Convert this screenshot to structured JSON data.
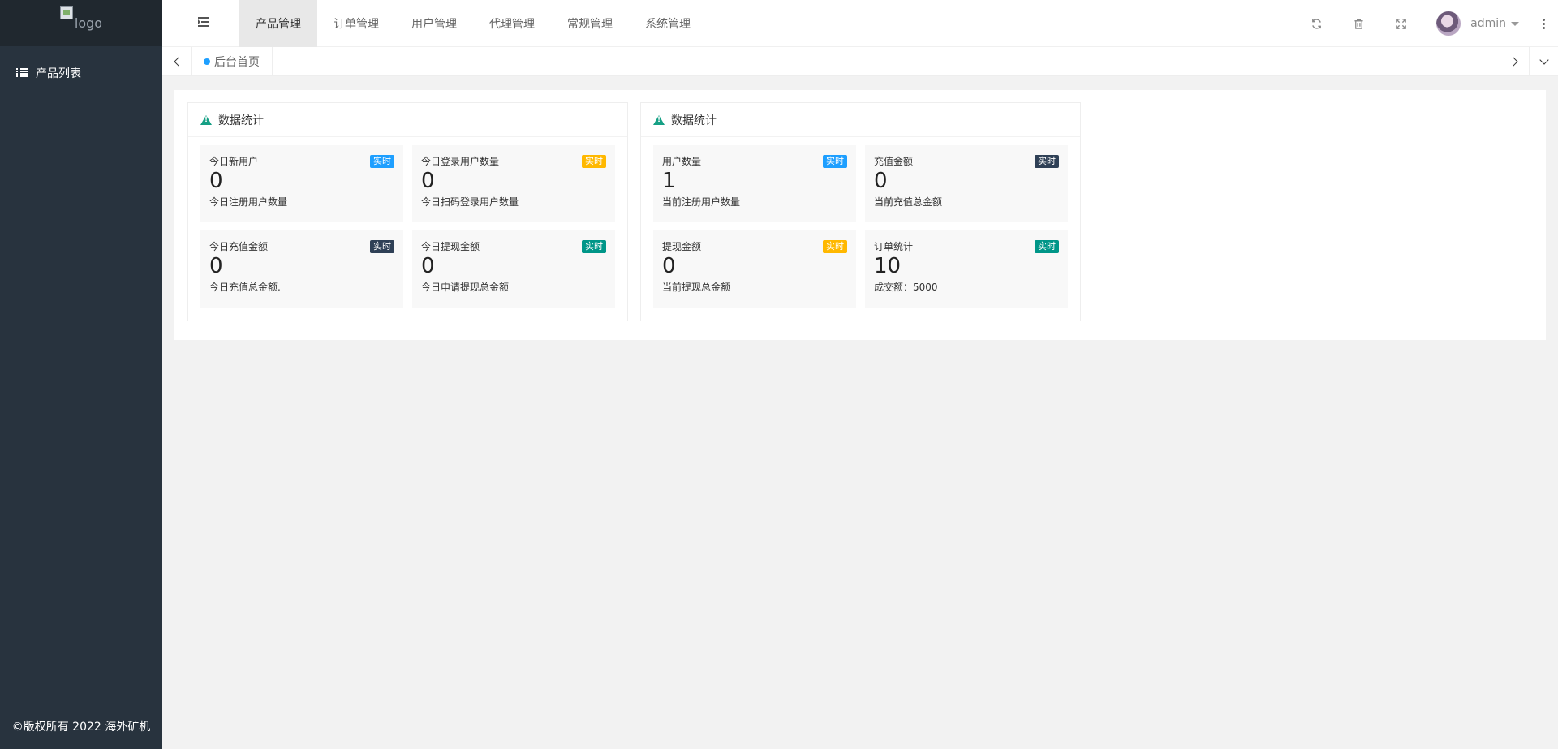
{
  "sidebar": {
    "logo_alt": "logo",
    "items": [
      {
        "label": "产品列表",
        "icon": "list-icon"
      }
    ],
    "copyright": "©版权所有 2022 海外矿机"
  },
  "header": {
    "nav": [
      {
        "label": "产品管理",
        "active": true
      },
      {
        "label": "订单管理"
      },
      {
        "label": "用户管理"
      },
      {
        "label": "代理管理"
      },
      {
        "label": "常规管理"
      },
      {
        "label": "系统管理"
      }
    ],
    "username": "admin",
    "icons": [
      "refresh-icon",
      "trash-icon",
      "fullscreen-icon",
      "more-icon"
    ]
  },
  "tabs": {
    "home_label": "后台首页",
    "home_dot_color": "#1e9fff"
  },
  "colors": {
    "blue": "#1e9fff",
    "orange": "#ffb800",
    "dark": "#2f4056",
    "green": "#009688",
    "accent_icon": "#16a085"
  },
  "cards": [
    {
      "title": "数据统计",
      "stats": [
        {
          "title": "今日新用户",
          "value": "0",
          "desc": "今日注册用户数量",
          "badge": "实时",
          "badge_color": "#1e9fff"
        },
        {
          "title": "今日登录用户数量",
          "value": "0",
          "desc": "今日扫码登录用户数量",
          "badge": "实时",
          "badge_color": "#ffb800"
        },
        {
          "title": "今日充值金额",
          "value": "0",
          "desc": "今日充值总金额.",
          "badge": "实时",
          "badge_color": "#2f4056"
        },
        {
          "title": "今日提现金额",
          "value": "0",
          "desc": "今日申请提现总金额",
          "badge": "实时",
          "badge_color": "#009688"
        }
      ]
    },
    {
      "title": "数据统计",
      "stats": [
        {
          "title": "用户数量",
          "value": "1",
          "desc": "当前注册用户数量",
          "badge": "实时",
          "badge_color": "#1e9fff"
        },
        {
          "title": "充值金额",
          "value": "0",
          "desc": "当前充值总金额",
          "badge": "实时",
          "badge_color": "#2f4056"
        },
        {
          "title": "提现金额",
          "value": "0",
          "desc": "当前提现总金额",
          "badge": "实时",
          "badge_color": "#ffb800"
        },
        {
          "title": "订单统计",
          "value": "10",
          "desc": "成交额：5000",
          "badge": "实时",
          "badge_color": "#009688"
        }
      ]
    }
  ]
}
